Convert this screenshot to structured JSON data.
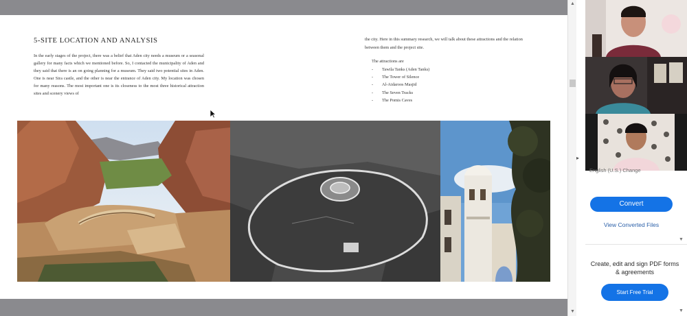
{
  "document": {
    "heading": "5-SITE LOCATION AND ANALYSIS",
    "paragraph_left": "In the early stages of the project, there was a belief that Aden city needs a museum or a seasonal gallery for many facts which we mentioned before. So, I contacted the municipality of Aden and they said that there is an on going planning for a museum. They said two potential sites in Aden. One is near Sira castle, and the other is near the entrance of Aden city. My location was chosen for many reasons. The most important one is its closeness to the most three historical attraction sites and scenery views of",
    "paragraph_right": "the city. Here in this summary research, we will talk about these attractions and the relation between them and the project site.",
    "attractions_title": "The attractions are",
    "attractions": [
      {
        "dash": "-",
        "label": "Tawila Tanks (Aden Tanks)"
      },
      {
        "dash": "-",
        "label": "The Tower of Silence"
      },
      {
        "dash": "-",
        "label": "Al-Aidaroos Masjid"
      },
      {
        "dash": "-",
        "label": "The Seven Tracks"
      },
      {
        "dash": "-",
        "label": "The Pomis Caves"
      }
    ],
    "images": [
      {
        "name": "tawila-tanks-photo"
      },
      {
        "name": "tower-of-silence-photo"
      },
      {
        "name": "aidaroos-masjid-photo"
      }
    ]
  },
  "scrollbar": {
    "up_icon": "chevron-up-icon",
    "down_icon": "chevron-down-icon"
  },
  "side_panel": {
    "language_text": "English (U.S.)  Change",
    "convert_label": "Convert",
    "view_converted_label": "View Converted Files",
    "promo_text": "Create, edit and sign PDF forms & agreements",
    "trial_label": "Start Free Trial"
  },
  "video_call": {
    "participants": [
      {
        "name": "participant-1"
      },
      {
        "name": "participant-2"
      },
      {
        "name": "participant-3"
      }
    ]
  },
  "colors": {
    "accent": "#1473e6",
    "gray_band": "#8a8a8e"
  }
}
